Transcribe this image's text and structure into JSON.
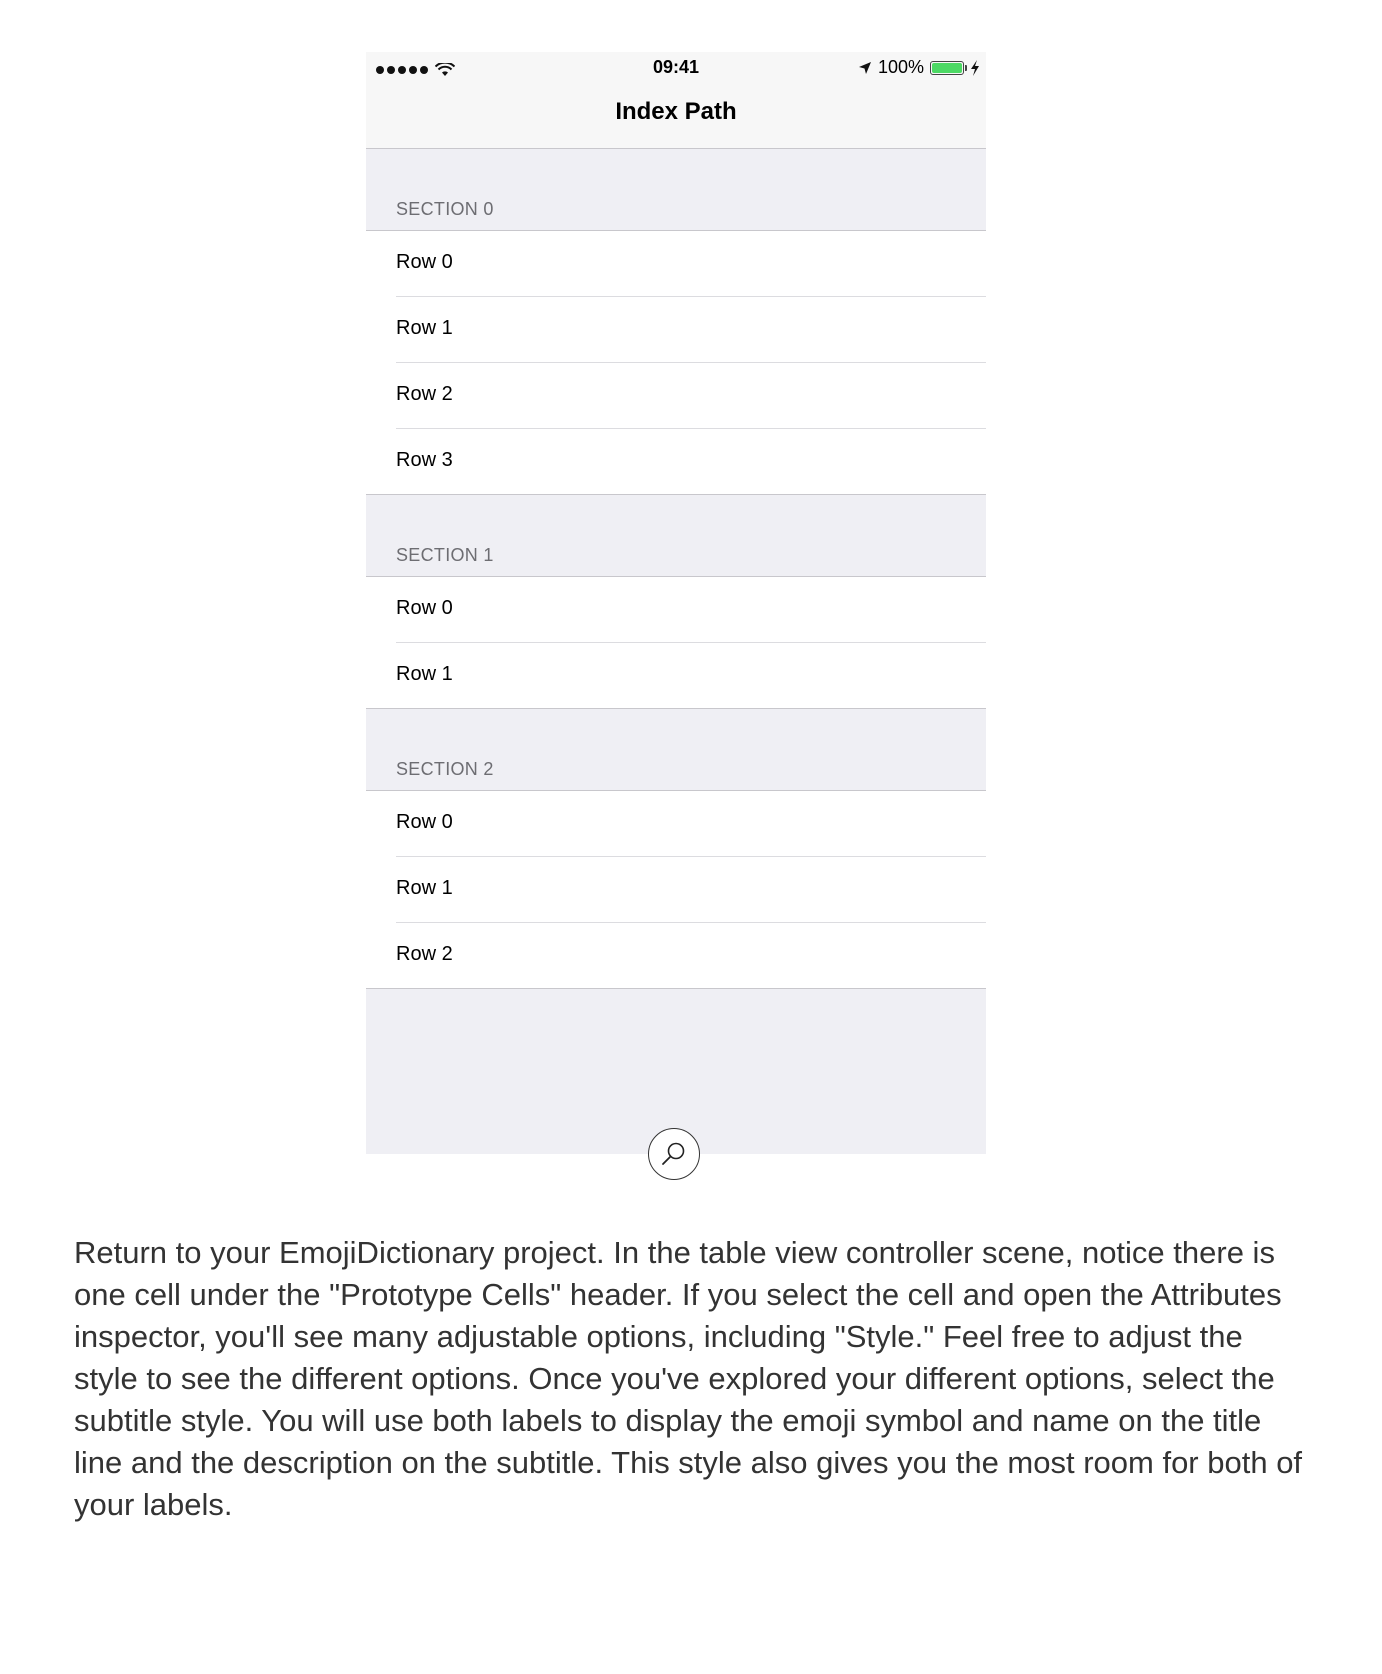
{
  "status_bar": {
    "time": "09:41",
    "battery": "100%",
    "battery_color": "#4cd964"
  },
  "nav": {
    "title": "Index Path"
  },
  "sections": [
    {
      "header": "SECTION 0",
      "rows": [
        "Row 0",
        "Row 1",
        "Row 2",
        "Row 3"
      ]
    },
    {
      "header": "SECTION 1",
      "rows": [
        "Row 0",
        "Row 1"
      ]
    },
    {
      "header": "SECTION 2",
      "rows": [
        "Row 0",
        "Row 1",
        "Row 2"
      ]
    }
  ],
  "icons": {
    "zoom": "magnifier-icon"
  },
  "paragraph": "Return to your EmojiDictionary project. In the table view controller scene, notice there is one cell under the \"Prototype Cells\" header. If you select the cell and open the Attributes inspector, you'll see many adjustable options, including \"Style.\" Feel free to adjust the style to see the different options. Once you've explored your different options, select the subtitle style. You will use both labels to display the emoji symbol and name on the title line and the description on the subtitle. This style also gives you the most room for both of your labels."
}
